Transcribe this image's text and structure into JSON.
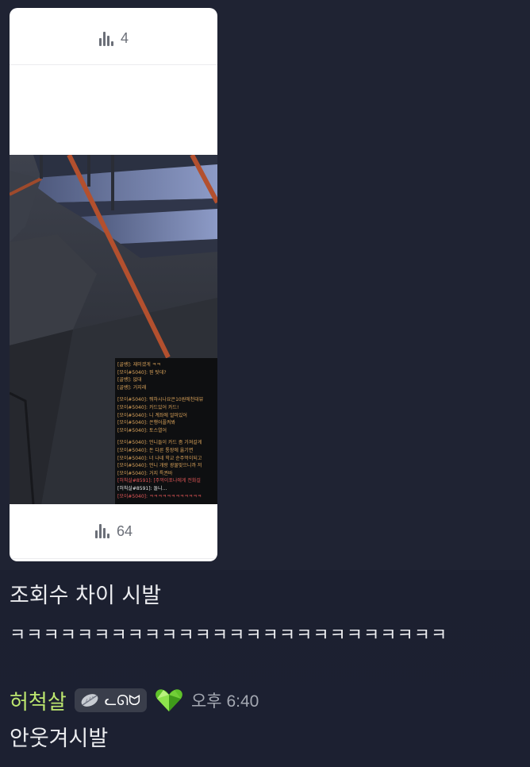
{
  "attachment": {
    "top_views": "4",
    "bottom_views": "64",
    "game_chat_lines": [
      {
        "text": "[골뱅]: 재미겠게 ㅋㅋ",
        "color": "o"
      },
      {
        "text": "[모이#5040]: 뭔 탓데?",
        "color": "o"
      },
      {
        "text": "[골뱅]: 없대",
        "color": "o"
      },
      {
        "text": "[골뱅]: 거지래",
        "color": "o"
      },
      {
        "text": "",
        "color": "gap"
      },
      {
        "text": "[모이#5040]: 뭐하시나요은10원에천대뷰",
        "color": "o"
      },
      {
        "text": "[모이#5040]: 카드있어 카드!",
        "color": "o"
      },
      {
        "text": "[모이#5040]: 니 계좌에 얼마있어",
        "color": "o"
      },
      {
        "text": "[모이#5040]: 은행어플켜봐",
        "color": "o"
      },
      {
        "text": "[모이#5040]: 토스열어",
        "color": "o"
      },
      {
        "text": "",
        "color": "gap"
      },
      {
        "text": "[모이#5040]: 언니들이 카드 좀 가져갈게",
        "color": "o"
      },
      {
        "text": "[모이#5040]: 돈 다른 통장에 옮기면",
        "color": "o"
      },
      {
        "text": "[모이#5040]: 너 나네 학교 순주먹이되고",
        "color": "o"
      },
      {
        "text": "[모이#5040]: 언니 개랑 광물맞으니까 저",
        "color": "o"
      },
      {
        "text": "[모이#5040]: 거지 특권바",
        "color": "o"
      },
      {
        "text": "[허칙살#8591]: [주먹이포나에게 전화걸",
        "color": "r"
      },
      {
        "text": "[허칙살#8591]: 돌니...",
        "color": "w"
      },
      {
        "text": "[모이#5040]: ㅋㅋㅋㅋㅋㅋㅋㅋㅋㅋㅋㅋ",
        "color": "r"
      }
    ]
  },
  "messages": {
    "line1": "조회수 차이 시발",
    "line2": "ㅋㅋㅋㅋㅋㅋㅋㅋㅋㅋㅋㅋㅋㅋㅋㅋㅋㅋㅋㅋㅋㅋㅋㅋㅋㅋ",
    "author": "허척살",
    "tag_text": "ᓚᘏᗢ",
    "timestamp": "오후 6:40",
    "line3": "안웃겨시발"
  },
  "colors": {
    "background": "#1e2230",
    "author": "#bde76f",
    "card": "#ffffff",
    "heart": "#6fd32a"
  }
}
